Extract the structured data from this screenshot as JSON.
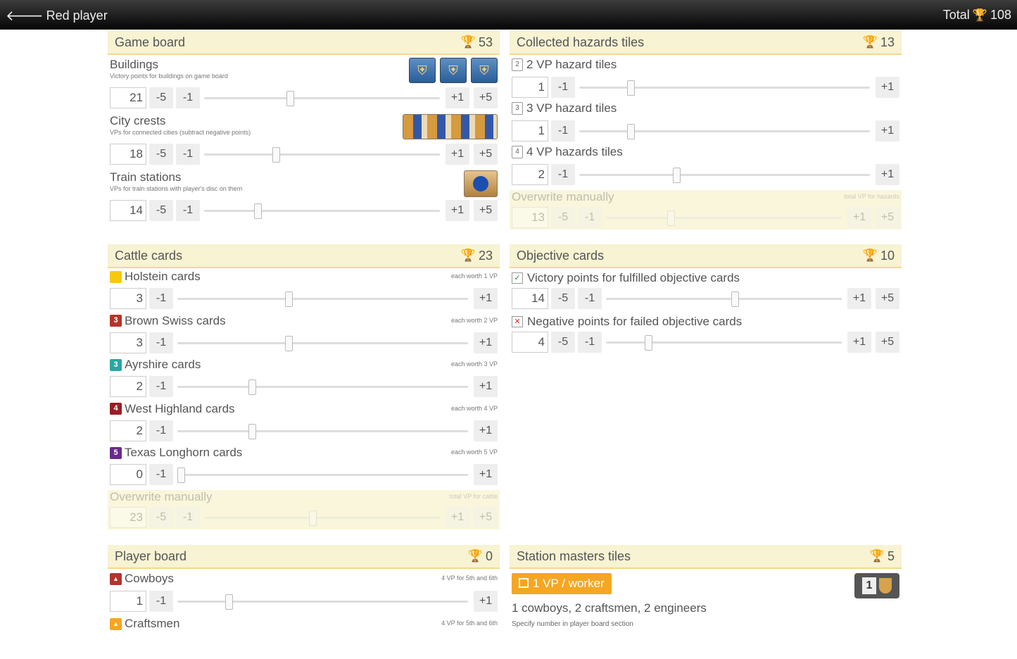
{
  "topbar": {
    "back_label": "Red player",
    "total_label": "Total",
    "total_value": "108"
  },
  "game_board": {
    "title": "Game board",
    "points": "53",
    "rows": [
      {
        "title": "Buildings",
        "desc": "Victory points for buildings on game board",
        "value": "21",
        "level": 0.36
      },
      {
        "title": "City crests",
        "desc": "VPs for connected cities (subtract negative points)",
        "value": "18",
        "level": 0.3
      },
      {
        "title": "Train stations",
        "desc": "VPs for train stations with player's disc on them",
        "value": "14",
        "level": 0.22
      }
    ],
    "buttons": {
      "m5": "-5",
      "m1": "-1",
      "p1": "+1",
      "p5": "+5"
    }
  },
  "hazards": {
    "title": "Collected hazards tiles",
    "points": "13",
    "rows": [
      {
        "icon": "2",
        "title": "2 VP hazard tiles",
        "value": "1",
        "level": 0.17
      },
      {
        "icon": "3",
        "title": "3 VP hazard tiles",
        "value": "1",
        "level": 0.17
      },
      {
        "icon": "4",
        "title": "4 VP hazards tiles",
        "value": "2",
        "level": 0.33
      }
    ],
    "manual": {
      "title": "Overwrite manually",
      "note": "total VP for hazards",
      "value": "13",
      "level": 0.27
    },
    "buttons": {
      "m5": "-5",
      "m1": "-1",
      "p1": "+1",
      "p5": "+5"
    }
  },
  "cattle": {
    "title": "Cattle cards",
    "points": "23",
    "rows": [
      {
        "badge": "",
        "color": "#f6c90e",
        "title": "Holstein cards",
        "note": "each worth 1 VP",
        "value": "3",
        "level": 0.38
      },
      {
        "badge": "3",
        "color": "#b3342b",
        "title": "Brown Swiss cards",
        "note": "each worth 2 VP",
        "value": "3",
        "level": 0.38
      },
      {
        "badge": "3",
        "color": "#2aa6a0",
        "title": "Ayrshire cards",
        "note": "each worth 3 VP",
        "value": "2",
        "level": 0.25
      },
      {
        "badge": "4",
        "color": "#9b1c24",
        "title": "West Highland cards",
        "note": "each worth 4 VP",
        "value": "2",
        "level": 0.25
      },
      {
        "badge": "5",
        "color": "#6a2a8a",
        "title": "Texas Longhorn cards",
        "note": "each worth 5 VP",
        "value": "0",
        "level": 0.0
      }
    ],
    "manual": {
      "title": "Overwrite manually",
      "note": "total VP for cattle",
      "value": "23",
      "level": 0.46
    },
    "buttons": {
      "m5": "-5",
      "m1": "-1",
      "p1": "+1",
      "p5": "+5"
    }
  },
  "objectives": {
    "title": "Objective cards",
    "points": "10",
    "rows": [
      {
        "mark": "✓",
        "mark_color": "#2e8b3e",
        "title": "Victory points for fulfilled objective cards",
        "value": "14",
        "level": 0.55
      },
      {
        "mark": "✕",
        "mark_color": "#d32f2f",
        "title": "Negative points for failed objective cards",
        "value": "4",
        "level": 0.17
      }
    ],
    "buttons": {
      "m5": "-5",
      "m1": "-1",
      "p1": "+1",
      "p5": "+5"
    }
  },
  "player_board": {
    "title": "Player board",
    "points": "0",
    "rows": [
      {
        "color": "#b3342b",
        "title": "Cowboys",
        "note": "4 VP for 5th and 6th",
        "value": "1",
        "level": 0.17
      },
      {
        "color": "#f5a623",
        "title": "Craftsmen",
        "note": "4 VP for 5th and 6th"
      }
    ],
    "buttons": {
      "m1": "-1",
      "p1": "+1"
    }
  },
  "station_masters": {
    "title": "Station masters tiles",
    "points": "5",
    "toggle_label": "1 VP / worker",
    "workers_text": "1 cowboys, 2 craftsmen, 2 engineers",
    "hint": "Specify number in player board section",
    "tile_number": "1"
  },
  "colors": {
    "accent": "#f5a623",
    "header_bg": "#f7f3d3",
    "header_border": "#f3d98a"
  }
}
